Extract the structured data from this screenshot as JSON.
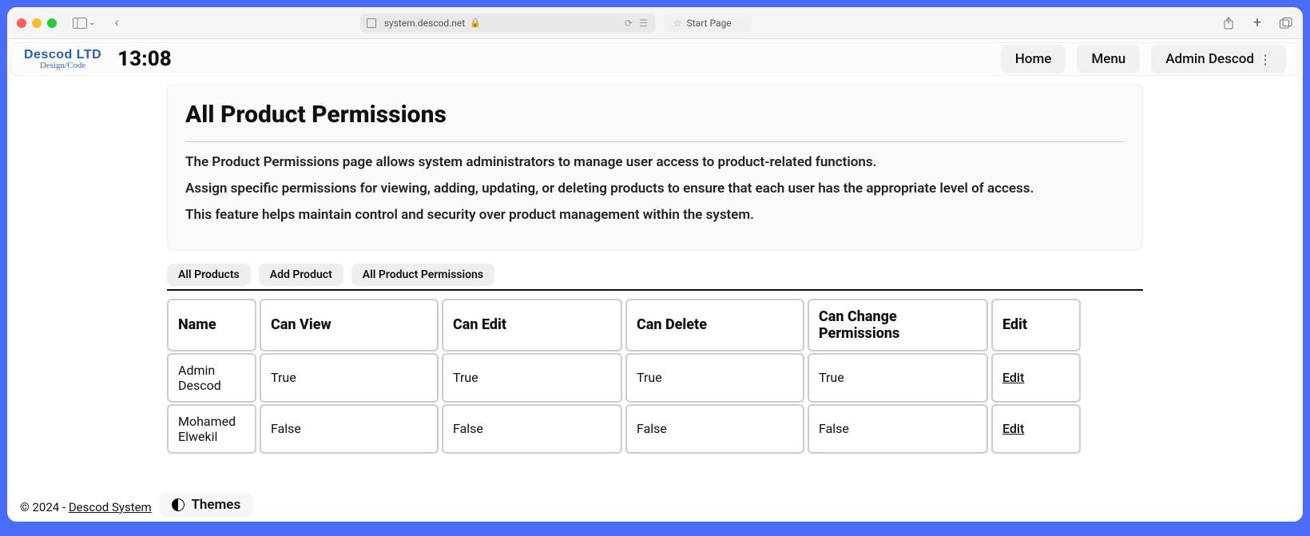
{
  "browser": {
    "url": "system.descod.net",
    "start_page": "Start Page"
  },
  "header": {
    "logo_top": "Descod LTD",
    "logo_sub": "Design/Code",
    "clock": "13:08",
    "nav": {
      "home": "Home",
      "menu": "Menu",
      "user": "Admin Descod"
    }
  },
  "intro": {
    "title": "All Product Permissions",
    "p1": "The Product Permissions page allows system administrators to manage user access to product-related functions.",
    "p2": "Assign specific permissions for viewing, adding, updating, or deleting products to ensure that each user has the appropriate level of access.",
    "p3": "This feature helps maintain control and security over product management within the system."
  },
  "tabs": {
    "all_products": "All Products",
    "add_product": "Add Product",
    "all_perm": "All Product Permissions"
  },
  "table": {
    "headers": {
      "name": "Name",
      "view": "Can View",
      "edit": "Can Edit",
      "del": "Can Delete",
      "chg": "Can Change Permissions",
      "act": "Edit"
    },
    "rows": [
      {
        "name": "Admin Descod",
        "view": "True",
        "edit": "True",
        "del": "True",
        "chg": "True",
        "act": "Edit"
      },
      {
        "name": "Mohamed Elwekil",
        "view": "False",
        "edit": "False",
        "del": "False",
        "chg": "False",
        "act": "Edit"
      }
    ]
  },
  "footer": {
    "copy": "© 2024 - ",
    "link": "Descod System"
  },
  "themes_label": "Themes"
}
